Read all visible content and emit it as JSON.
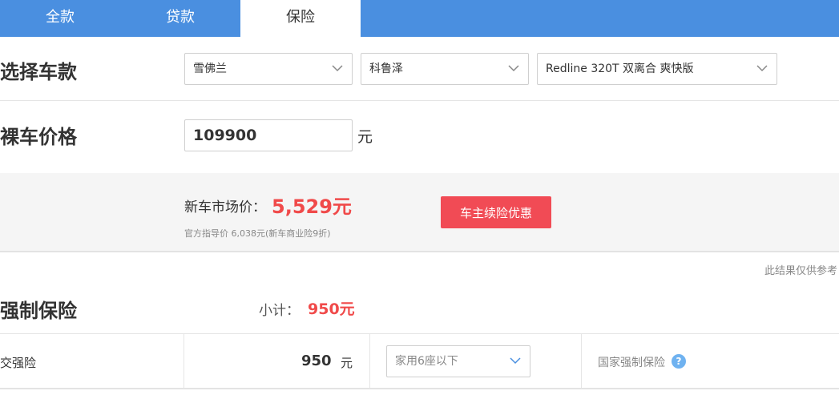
{
  "tabs": [
    {
      "label": "全款"
    },
    {
      "label": "贷款"
    },
    {
      "label": "保险"
    }
  ],
  "active_tab": "保险",
  "car_selection": {
    "label": "选择车款",
    "brand": "雪佛兰",
    "series": "科鲁泽",
    "model": "Redline 320T 双离合 爽快版"
  },
  "car_price": {
    "label": "裸车价格",
    "value": "109900",
    "unit": "元"
  },
  "market": {
    "label": "新车市场价：",
    "value": "5,529元",
    "sub": "官方指导价 6,038元(新车商业险9折)",
    "promo_button": "车主续险优惠"
  },
  "disclaimer": "此结果仅供参考",
  "compulsory": {
    "label": "强制保险",
    "subtotal_label": "小计：",
    "subtotal_value": "950元",
    "items": [
      {
        "name": "交强险",
        "amount": "950",
        "unit": "元",
        "type": "家用6座以下",
        "note": "国家强制保险",
        "help_icon": "question-icon"
      }
    ]
  },
  "colors": {
    "accent_blue": "#4a8fe0",
    "price_red": "#f04a4a",
    "button_red": "#f14b55"
  }
}
